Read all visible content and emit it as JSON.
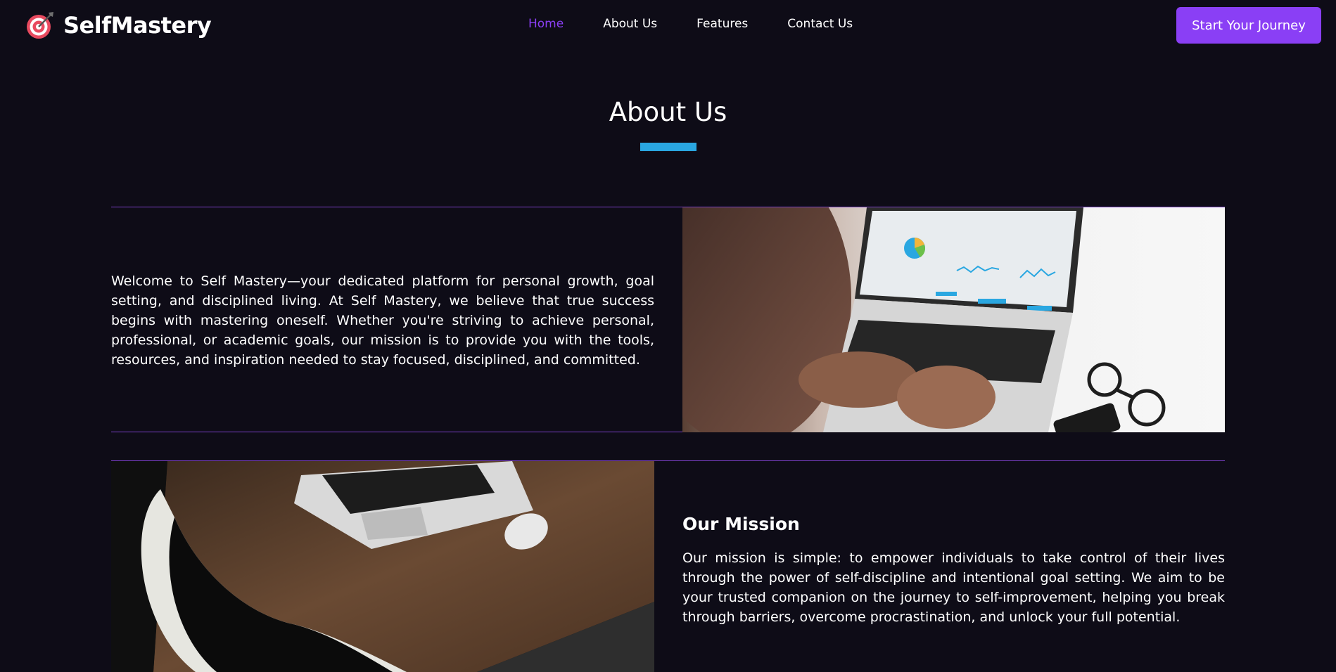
{
  "brand": {
    "name": "SelfMastery",
    "icon": "target-icon"
  },
  "nav": {
    "items": [
      {
        "label": "Home",
        "active": true
      },
      {
        "label": "About Us",
        "active": false
      },
      {
        "label": "Features",
        "active": false
      },
      {
        "label": "Contact Us",
        "active": false
      }
    ],
    "cta_label": "Start Your Journey"
  },
  "about": {
    "title": "About Us",
    "intro": "Welcome to Self Mastery—your dedicated platform for personal growth, goal setting, and disciplined living. At Self Mastery, we believe that true success begins with mastering oneself. Whether you're striving to achieve personal, professional, or academic goals, our mission is to provide you with the tools, resources, and inspiration needed to stay focused, disciplined, and committed.",
    "mission_title": "Our Mission",
    "mission_text": "Our mission is simple: to empower individuals to take control of their lives through the power of self-discipline and intentional goal setting. We aim to be your trusted companion on the journey to self-improvement, helping you break through barriers, overcome procrastination, and unlock your full potential."
  },
  "colors": {
    "background": "#0e0c17",
    "accent": "#8a3ff5",
    "underline": "#2aa7e1",
    "divider": "#7b3fc7"
  }
}
